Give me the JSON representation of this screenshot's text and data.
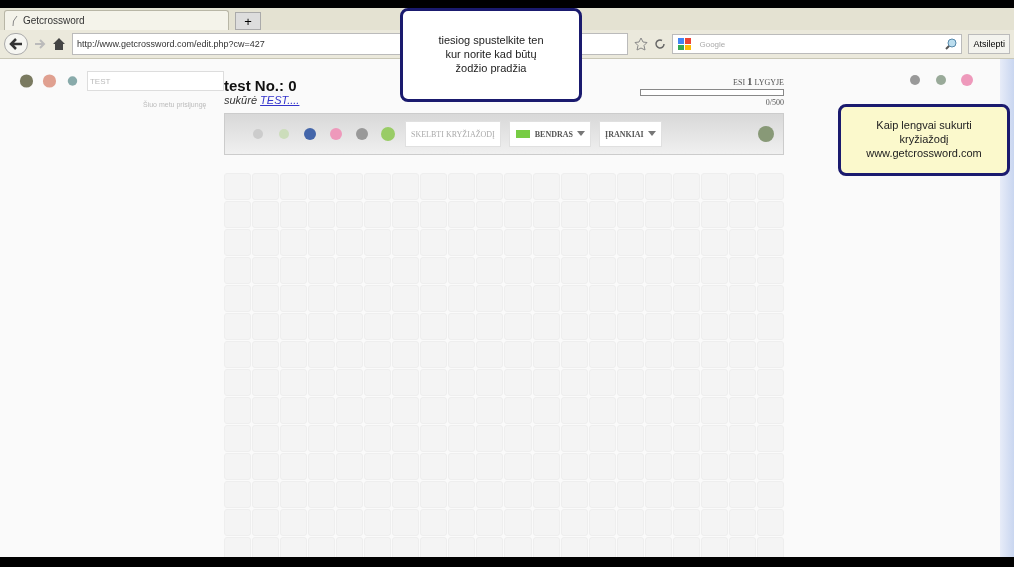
{
  "browser": {
    "tab_title": "Getcrossword",
    "new_tab": "+",
    "url": "http://www.getcrossword.com/edit.php?cw=427",
    "search_placeholder": "Google",
    "menu_button": "Atsilepti"
  },
  "page": {
    "search": {
      "placeholder": "TEST"
    },
    "online_note": "Šiuo metu prisijungę",
    "title": "test No.: 0",
    "author_label": "sukūrė",
    "author_link": "TEST....",
    "level": {
      "prefix": "ESI",
      "number": "1",
      "suffix": "LYGYJE",
      "level": 0,
      "reading": "0/500"
    },
    "toolbar": {
      "publish": "SKELBTI KRYŽIAŽODĮ",
      "menus": [
        {
          "label": "BENDRAS",
          "icon": true
        },
        {
          "label": "ĮRANKIAI",
          "icon": false
        }
      ]
    }
  },
  "callouts": [
    {
      "kind": "top",
      "lines": [
        "tiesiog spustelkite ten",
        "kur norite kad būtų",
        "žodžio pradžia"
      ]
    },
    {
      "kind": "side",
      "lines": [
        "Kaip lengvai sukurti",
        "kryžiažodį",
        "www.getcrossword.com"
      ]
    }
  ]
}
